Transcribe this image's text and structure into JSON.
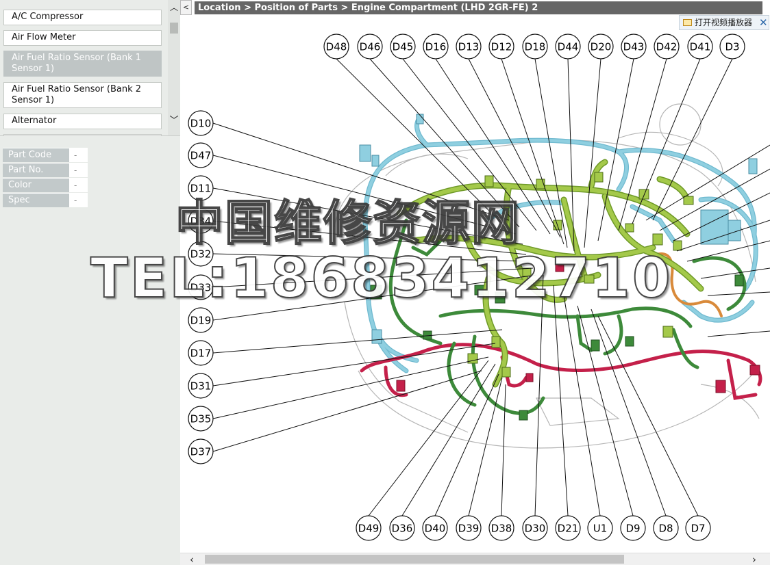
{
  "parts_list": {
    "items": [
      {
        "label": "A/C Compressor",
        "selected": false
      },
      {
        "label": "Air Flow Meter",
        "selected": false
      },
      {
        "label": "Air Fuel Ratio Sensor (Bank 1 Sensor 1)",
        "selected": true
      },
      {
        "label": "Air Fuel Ratio Sensor (Bank 2 Sensor 1)",
        "selected": false
      },
      {
        "label": "Alternator",
        "selected": false
      }
    ],
    "scroll_up_icon": "chevron-up-icon",
    "scroll_down_icon": "chevron-down-icon"
  },
  "properties": [
    {
      "label": "Part Code",
      "value": "-"
    },
    {
      "label": "Part No.",
      "value": "-"
    },
    {
      "label": "Color",
      "value": "-"
    },
    {
      "label": "Spec",
      "value": "-"
    }
  ],
  "collapse_handle": "<",
  "breadcrumb": "Location > Position of Parts > Engine Compartment (LHD 2GR-FE) 2",
  "video_player": {
    "label": "打开视频播放器",
    "icon": "folder-video-icon",
    "close": "✕"
  },
  "diagram": {
    "top_callouts": [
      "D48",
      "D46",
      "D45",
      "D16",
      "D13",
      "D12",
      "D18",
      "D44",
      "D20",
      "D43",
      "D42",
      "D41",
      "D3"
    ],
    "left_callouts": [
      "D10",
      "D47",
      "D11",
      "D34",
      "D32",
      "D33",
      "D19",
      "D17",
      "D31",
      "D35",
      "D37"
    ],
    "bottom_callouts": [
      "D49",
      "D36",
      "D40",
      "D39",
      "D38",
      "D30",
      "D21",
      "U1",
      "D9",
      "D8",
      "D7"
    ],
    "colors": {
      "coolant_blue": "#8fcfe0",
      "harness_lime": "#a4c94a",
      "harness_green": "#3d8a3a",
      "harness_red": "#c4204a",
      "harness_orange": "#d98a3a",
      "outline_gray": "#b5b5b5"
    }
  },
  "watermark": {
    "line1": "中国维修资源网",
    "line2": "TEL:18683412710"
  },
  "h_scrollbar": {
    "left_icon": "‹",
    "right_icon": "›"
  }
}
